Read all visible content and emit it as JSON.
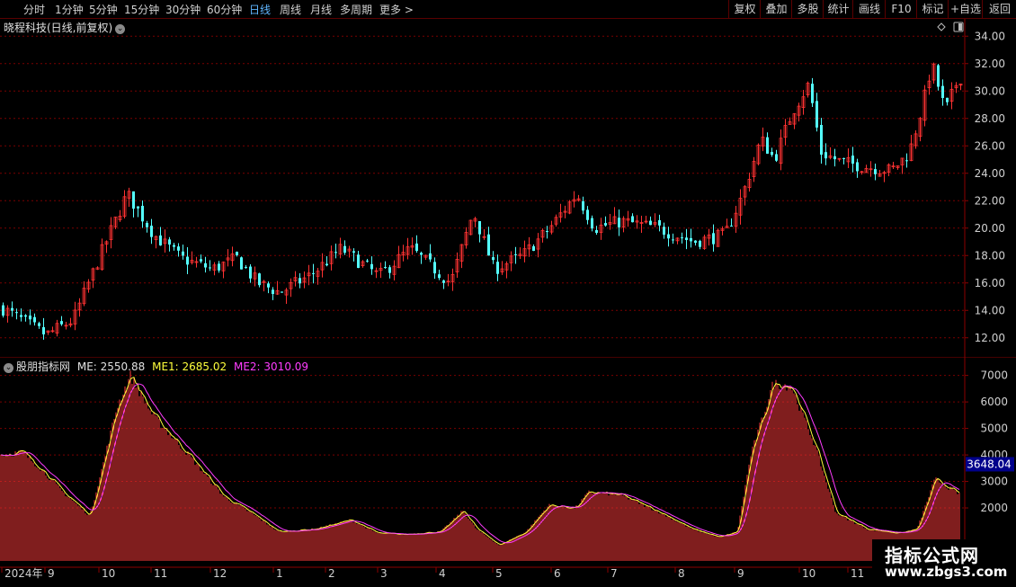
{
  "toolbar": {
    "periods": [
      "分时",
      "1分钟",
      "5分钟",
      "15分钟",
      "30分钟",
      "60分钟",
      "日线",
      "周线",
      "月线",
      "多周期",
      "更多 >"
    ],
    "active_period": "日线",
    "right_buttons": [
      "复权",
      "叠加",
      "多股",
      "统计",
      "画线",
      "F10",
      "标记",
      "+自选",
      "返回"
    ]
  },
  "stock": {
    "title": "晓程科技(日线,前复权)",
    "title_icon": "chevron-down-icon",
    "corner_icons": [
      "diamond-icon",
      "panel-toggle-icon"
    ]
  },
  "indicator": {
    "name": "股朋指标网",
    "me_label": "ME: 2550.88",
    "me1_label": "ME1: 2685.02",
    "me2_label": "ME2: 3010.09",
    "current_value": "3648.04"
  },
  "x_axis_labels": [
    "2024年",
    "9",
    "10",
    "11",
    "12",
    "1",
    "2",
    "3",
    "4",
    "5",
    "6",
    "7",
    "8",
    "9",
    "10",
    "11"
  ],
  "watermark": {
    "line1": "指标公式网",
    "line2": "www.zbgs3.com"
  },
  "chart_data": [
    {
      "type": "candlestick",
      "title": "晓程科技(日线,前复权)",
      "ylim": [
        11,
        35
      ],
      "y_ticks": [
        "12.00",
        "14.00",
        "16.00",
        "18.00",
        "20.00",
        "22.00",
        "24.00",
        "26.00",
        "28.00",
        "30.00",
        "32.00",
        "34.00"
      ],
      "close_anchors": [
        [
          0,
          14.2
        ],
        [
          50,
          12.2
        ],
        [
          80,
          13.3
        ],
        [
          110,
          18.0
        ],
        [
          140,
          22.5
        ],
        [
          170,
          19.5
        ],
        [
          200,
          17.8
        ],
        [
          235,
          17.0
        ],
        [
          262,
          17.8
        ],
        [
          285,
          16.0
        ],
        [
          310,
          15.3
        ],
        [
          345,
          16.6
        ],
        [
          378,
          18.5
        ],
        [
          420,
          16.5
        ],
        [
          455,
          18.5
        ],
        [
          500,
          16.0
        ],
        [
          525,
          21.2
        ],
        [
          548,
          17.0
        ],
        [
          580,
          18.0
        ],
        [
          610,
          20.0
        ],
        [
          640,
          22.5
        ],
        [
          660,
          20.0
        ],
        [
          690,
          20.5
        ],
        [
          730,
          20.0
        ],
        [
          770,
          19.0
        ],
        [
          805,
          19.5
        ],
        [
          825,
          22.5
        ],
        [
          845,
          26.5
        ],
        [
          860,
          25.0
        ],
        [
          880,
          28.5
        ],
        [
          898,
          30.5
        ],
        [
          912,
          25.5
        ],
        [
          935,
          24.8
        ],
        [
          960,
          24.5
        ],
        [
          990,
          24.2
        ],
        [
          1010,
          25.5
        ],
        [
          1025,
          29.0
        ],
        [
          1035,
          32.0
        ],
        [
          1050,
          28.5
        ],
        [
          1065,
          31.0
        ]
      ],
      "up_color": "#ff3232",
      "down_color": "#54ffff"
    },
    {
      "type": "bar+line",
      "title": "股朋指标网",
      "ylim": [
        0,
        7700
      ],
      "y_ticks": [
        "2000",
        "3000",
        "4000",
        "5000",
        "6000",
        "7000"
      ],
      "bar_anchors": [
        [
          0,
          4000
        ],
        [
          25,
          4100
        ],
        [
          45,
          3500
        ],
        [
          70,
          2600
        ],
        [
          100,
          1700
        ],
        [
          115,
          3700
        ],
        [
          130,
          5800
        ],
        [
          145,
          7000
        ],
        [
          170,
          5500
        ],
        [
          210,
          4000
        ],
        [
          250,
          2400
        ],
        [
          280,
          1800
        ],
        [
          310,
          1100
        ],
        [
          350,
          1200
        ],
        [
          390,
          1550
        ],
        [
          420,
          1050
        ],
        [
          450,
          1000
        ],
        [
          490,
          1100
        ],
        [
          515,
          1900
        ],
        [
          530,
          1200
        ],
        [
          555,
          600
        ],
        [
          585,
          1100
        ],
        [
          610,
          2100
        ],
        [
          640,
          2000
        ],
        [
          655,
          2600
        ],
        [
          690,
          2500
        ],
        [
          730,
          1900
        ],
        [
          770,
          1200
        ],
        [
          800,
          900
        ],
        [
          820,
          1100
        ],
        [
          835,
          4000
        ],
        [
          860,
          6700
        ],
        [
          880,
          6600
        ],
        [
          905,
          4500
        ],
        [
          930,
          1800
        ],
        [
          965,
          1200
        ],
        [
          1000,
          1050
        ],
        [
          1020,
          1200
        ],
        [
          1040,
          3100
        ],
        [
          1065,
          2550
        ]
      ],
      "series": [
        {
          "name": "ME1",
          "color": "#ffff3c"
        },
        {
          "name": "ME2",
          "color": "#ff3cff"
        }
      ],
      "bar_color": "#ff3c3c"
    }
  ]
}
